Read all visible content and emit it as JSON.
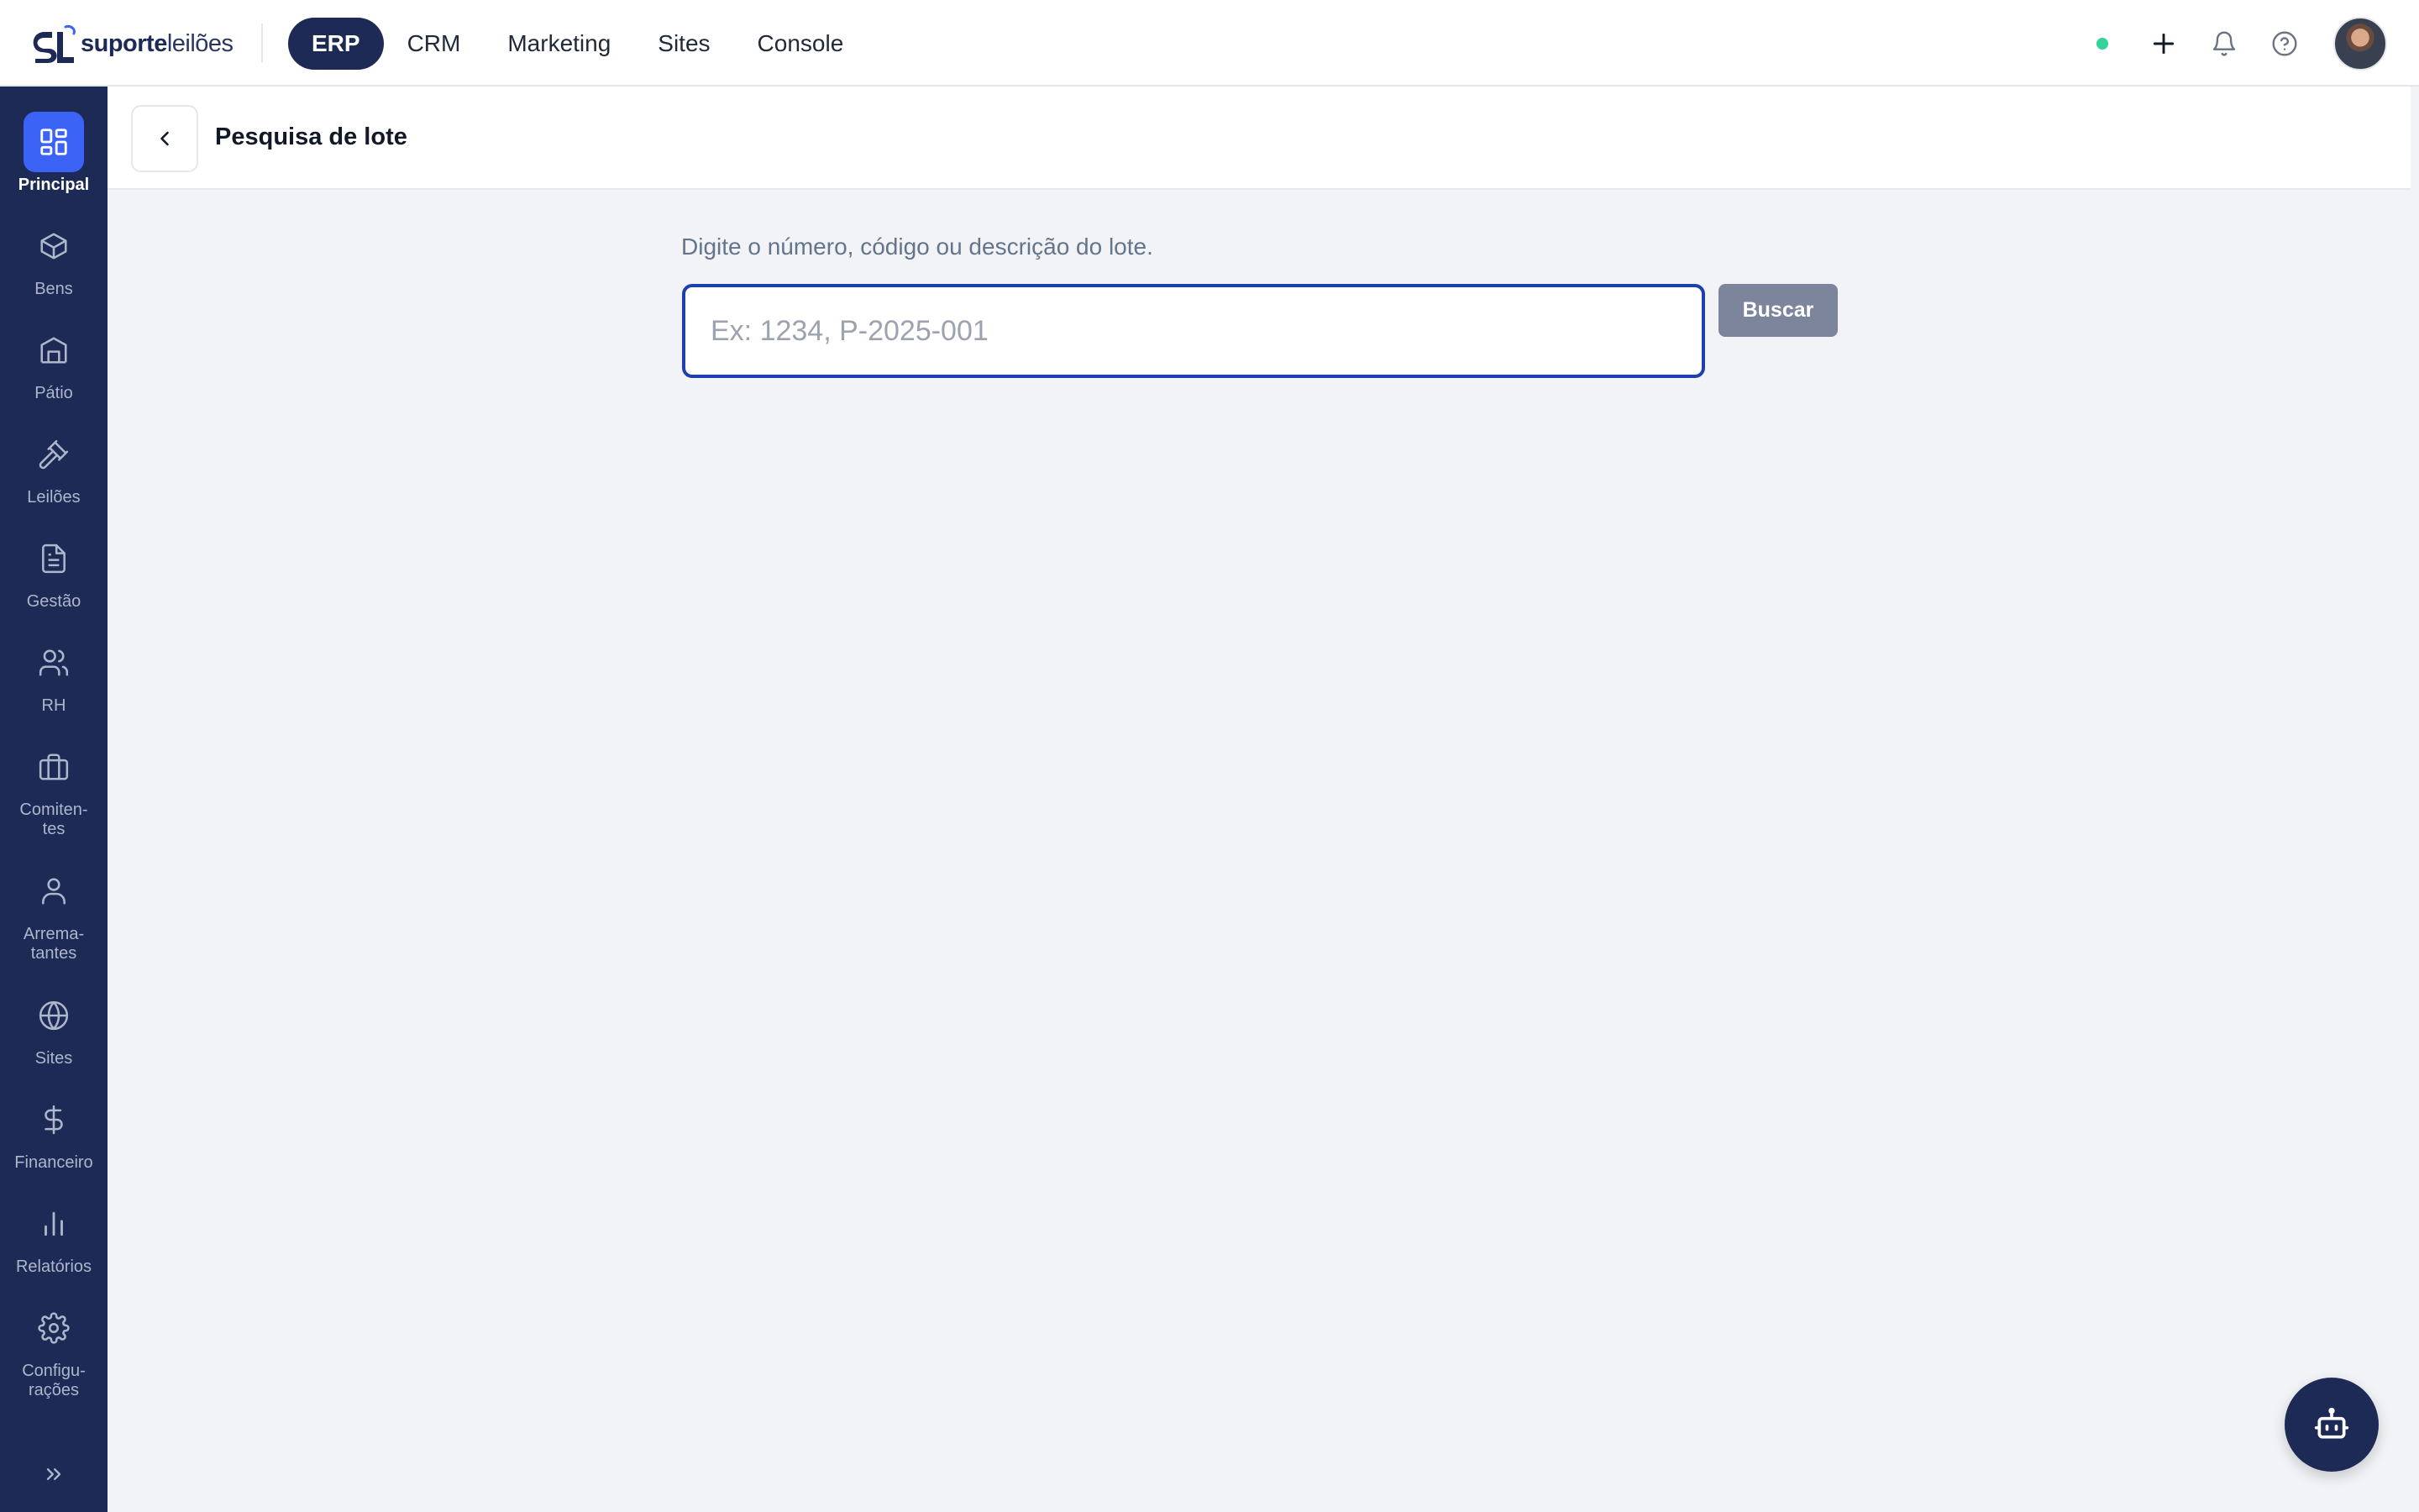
{
  "app": {
    "brand_bold": "suporte",
    "brand_light": "leilões",
    "logo_mark_text": "SL"
  },
  "topnav": {
    "items": [
      {
        "label": "ERP",
        "active": true
      },
      {
        "label": "CRM",
        "active": false
      },
      {
        "label": "Marketing",
        "active": false
      },
      {
        "label": "Sites",
        "active": false
      },
      {
        "label": "Console",
        "active": false
      }
    ]
  },
  "topbar_right": {
    "status": "online",
    "status_color": "#34d399",
    "icons": [
      "plus-icon",
      "bell-icon",
      "help-icon"
    ]
  },
  "sidebar": {
    "items": [
      {
        "label": "Principal",
        "icon": "dashboard-icon",
        "active": true
      },
      {
        "label": "Bens",
        "icon": "box-icon",
        "active": false
      },
      {
        "label": "Pátio",
        "icon": "building-icon",
        "active": false
      },
      {
        "label": "Leilões",
        "icon": "gavel-icon",
        "active": false
      },
      {
        "label": "Gestão",
        "icon": "document-icon",
        "active": false
      },
      {
        "label": "RH",
        "icon": "users-icon",
        "active": false
      },
      {
        "label": "Comiten-\ntes",
        "icon": "briefcase-icon",
        "active": false
      },
      {
        "label": "Arrema-\ntantes",
        "icon": "user-icon",
        "active": false
      },
      {
        "label": "Sites",
        "icon": "globe-icon",
        "active": false
      },
      {
        "label": "Financeiro",
        "icon": "dollar-icon",
        "active": false
      },
      {
        "label": "Relatórios",
        "icon": "bar-chart-icon",
        "active": false
      },
      {
        "label": "Configu-\nrações",
        "icon": "gear-icon",
        "active": false
      }
    ],
    "collapse_icon": "chevrons-right-icon"
  },
  "page": {
    "title": "Pesquisa de lote",
    "search_hint": "Digite o número, código ou descrição do lote.",
    "search_placeholder": "Ex: 1234, P-2025-001",
    "search_value": "",
    "search_button": "Buscar"
  },
  "colors": {
    "primary_dark": "#1c2a55",
    "accent_blue": "#3b64f6",
    "input_border": "#1e40af",
    "button_disabled": "#7d859c",
    "background": "#f1f3f6"
  }
}
